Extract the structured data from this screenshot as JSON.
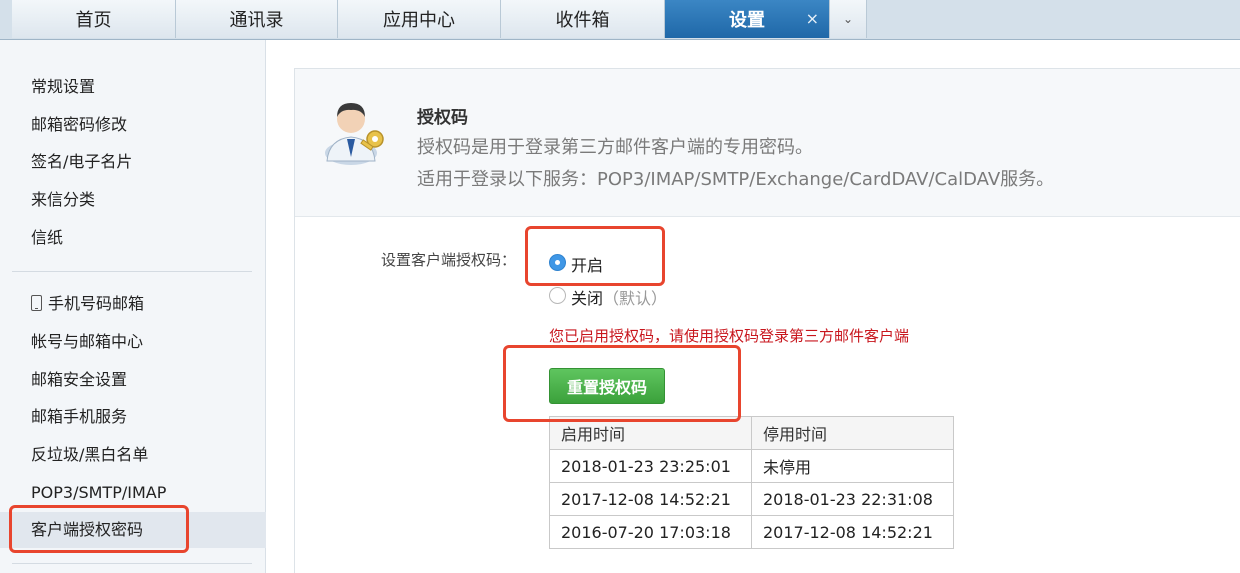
{
  "tabs": [
    {
      "label": "首页"
    },
    {
      "label": "通讯录"
    },
    {
      "label": "应用中心"
    },
    {
      "label": "收件箱"
    },
    {
      "label": "设置",
      "active": true
    }
  ],
  "tab_close_glyph": "×",
  "tab_more_glyph": "⌄",
  "sidebar": {
    "group1": [
      "常规设置",
      "邮箱密码修改",
      "签名/电子名片",
      "来信分类",
      "信纸"
    ],
    "group2": [
      "手机号码邮箱",
      "帐号与邮箱中心",
      "邮箱安全设置",
      "邮箱手机服务",
      "反垃圾/黑白名单",
      "POP3/SMTP/IMAP",
      "客户端授权密码"
    ],
    "active": "客户端授权密码"
  },
  "auth": {
    "title": "授权码",
    "desc1": "授权码是用于登录第三方邮件客户端的专用密码。",
    "desc2": "适用于登录以下服务：POP3/IMAP/SMTP/Exchange/CardDAV/CalDAV服务。",
    "field_label": "设置客户端授权码：",
    "option_on": "开启",
    "option_off": "关闭",
    "option_off_note": "（默认）",
    "selected": "开启",
    "notice": "您已启用授权码，请使用授权码登录第三方邮件客户端",
    "reset_button": "重置授权码"
  },
  "history": {
    "headers": [
      "启用时间",
      "停用时间"
    ],
    "rows": [
      [
        "2018-01-23 23:25:01",
        "未停用"
      ],
      [
        "2017-12-08 14:52:21",
        "2018-01-23 22:31:08"
      ],
      [
        "2016-07-20 17:03:18",
        "2017-12-08 14:52:21"
      ]
    ]
  },
  "colors": {
    "active_tab": "#2a74b6",
    "annotation": "#e8452e",
    "button": "#48af48",
    "notice": "#c8161d",
    "radio_selected": "#3f97e6"
  }
}
